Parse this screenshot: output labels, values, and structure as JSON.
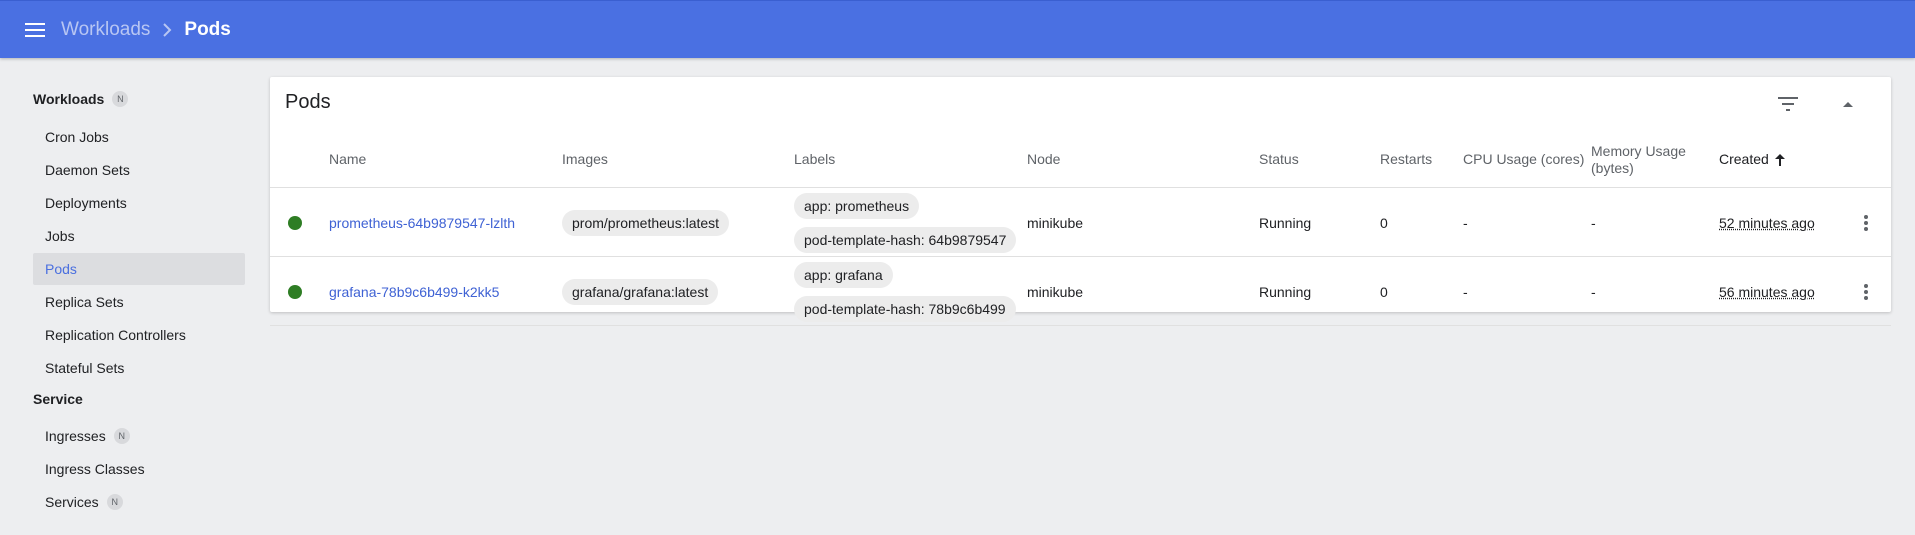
{
  "toolbar": {
    "breadcrumb_parent": "Workloads",
    "breadcrumb_current": "Pods"
  },
  "sidebar": {
    "groups": [
      {
        "label": "Workloads",
        "badge": "N",
        "items": [
          {
            "label": "Cron Jobs"
          },
          {
            "label": "Daemon Sets"
          },
          {
            "label": "Deployments"
          },
          {
            "label": "Jobs"
          },
          {
            "label": "Pods",
            "active": true
          },
          {
            "label": "Replica Sets"
          },
          {
            "label": "Replication Controllers"
          },
          {
            "label": "Stateful Sets"
          }
        ]
      },
      {
        "label": "Service",
        "items": [
          {
            "label": "Ingresses",
            "badge": "N"
          },
          {
            "label": "Ingress Classes"
          },
          {
            "label": "Services",
            "badge": "N"
          }
        ]
      }
    ]
  },
  "card": {
    "title": "Pods",
    "columns": {
      "name": "Name",
      "images": "Images",
      "labels": "Labels",
      "node": "Node",
      "status": "Status",
      "restarts": "Restarts",
      "cpu": "CPU Usage (cores)",
      "memory_line1": "Memory Usage",
      "memory_line2": "(bytes)",
      "created": "Created"
    },
    "rows": [
      {
        "name": "prometheus-64b9879547-lzlth",
        "image": "prom/prometheus:latest",
        "labels": [
          "app: prometheus",
          "pod-template-hash: 64b9879547"
        ],
        "node": "minikube",
        "status": "Running",
        "restarts": "0",
        "cpu": "-",
        "memory": "-",
        "created": "52 minutes ago"
      },
      {
        "name": "grafana-78b9c6b499-k2kk5",
        "image": "grafana/grafana:latest",
        "labels": [
          "app: grafana",
          "pod-template-hash: 78b9c6b499"
        ],
        "node": "minikube",
        "status": "Running",
        "restarts": "0",
        "cpu": "-",
        "memory": "-",
        "created": "56 minutes ago"
      }
    ]
  },
  "colors": {
    "toolbar": "#4a70e2",
    "status_running": "#2e7d24",
    "link": "#3f62d4"
  },
  "icons": [
    "menu-icon",
    "chevron-right-icon",
    "filter-icon",
    "collapse-icon",
    "sort-arrow-up-icon",
    "more-vert-icon"
  ]
}
